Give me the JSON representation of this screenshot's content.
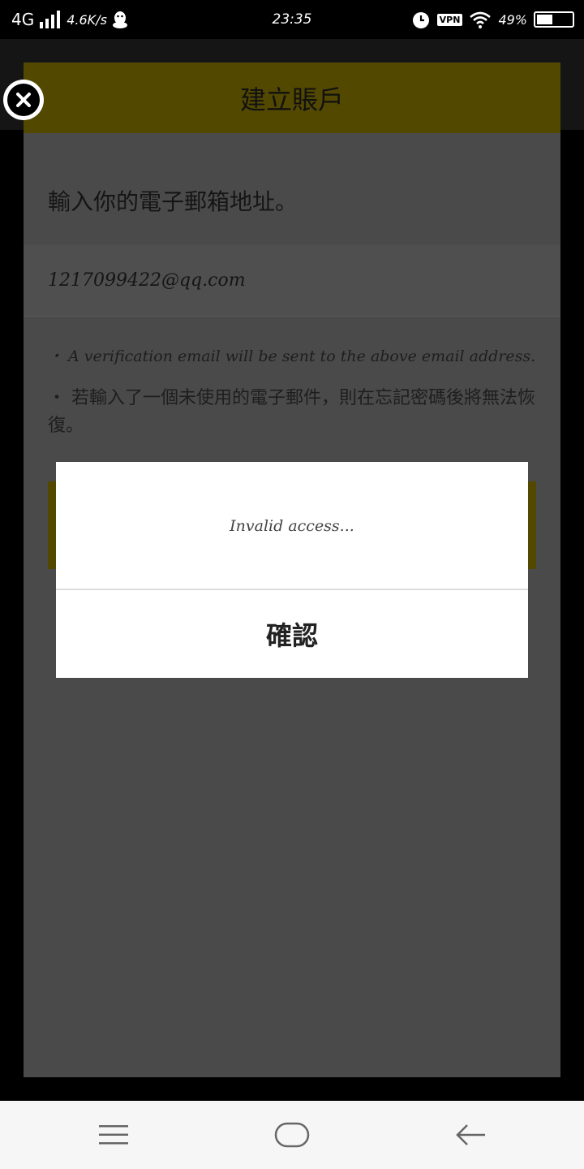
{
  "status_bar": {
    "network": "4G",
    "net_speed": "4.6K/s",
    "time": "23:35",
    "vpn": "VPN",
    "battery_percent": "49%",
    "battery_level": 0.49
  },
  "page": {
    "header_title": "建立賬戶",
    "prompt": "輸入你的電子郵箱地址。",
    "email_value": "1217099422@qq.com",
    "note_1": "・ A verification email will be sent to the above email address.",
    "note_2": "・ 若輸入了一個未使用的電子郵件，則在忘記密碼後將無法恢復。"
  },
  "dialog": {
    "message": "Invalid access...",
    "confirm_label": "確認"
  },
  "icons": {
    "close": "close-circle-icon",
    "menu": "menu-icon",
    "home": "home-icon",
    "back": "back-arrow-icon"
  },
  "colors": {
    "header_bg": "#524800",
    "dialog_bg": "#ffffff",
    "nav_bg": "#f6f6f6"
  }
}
